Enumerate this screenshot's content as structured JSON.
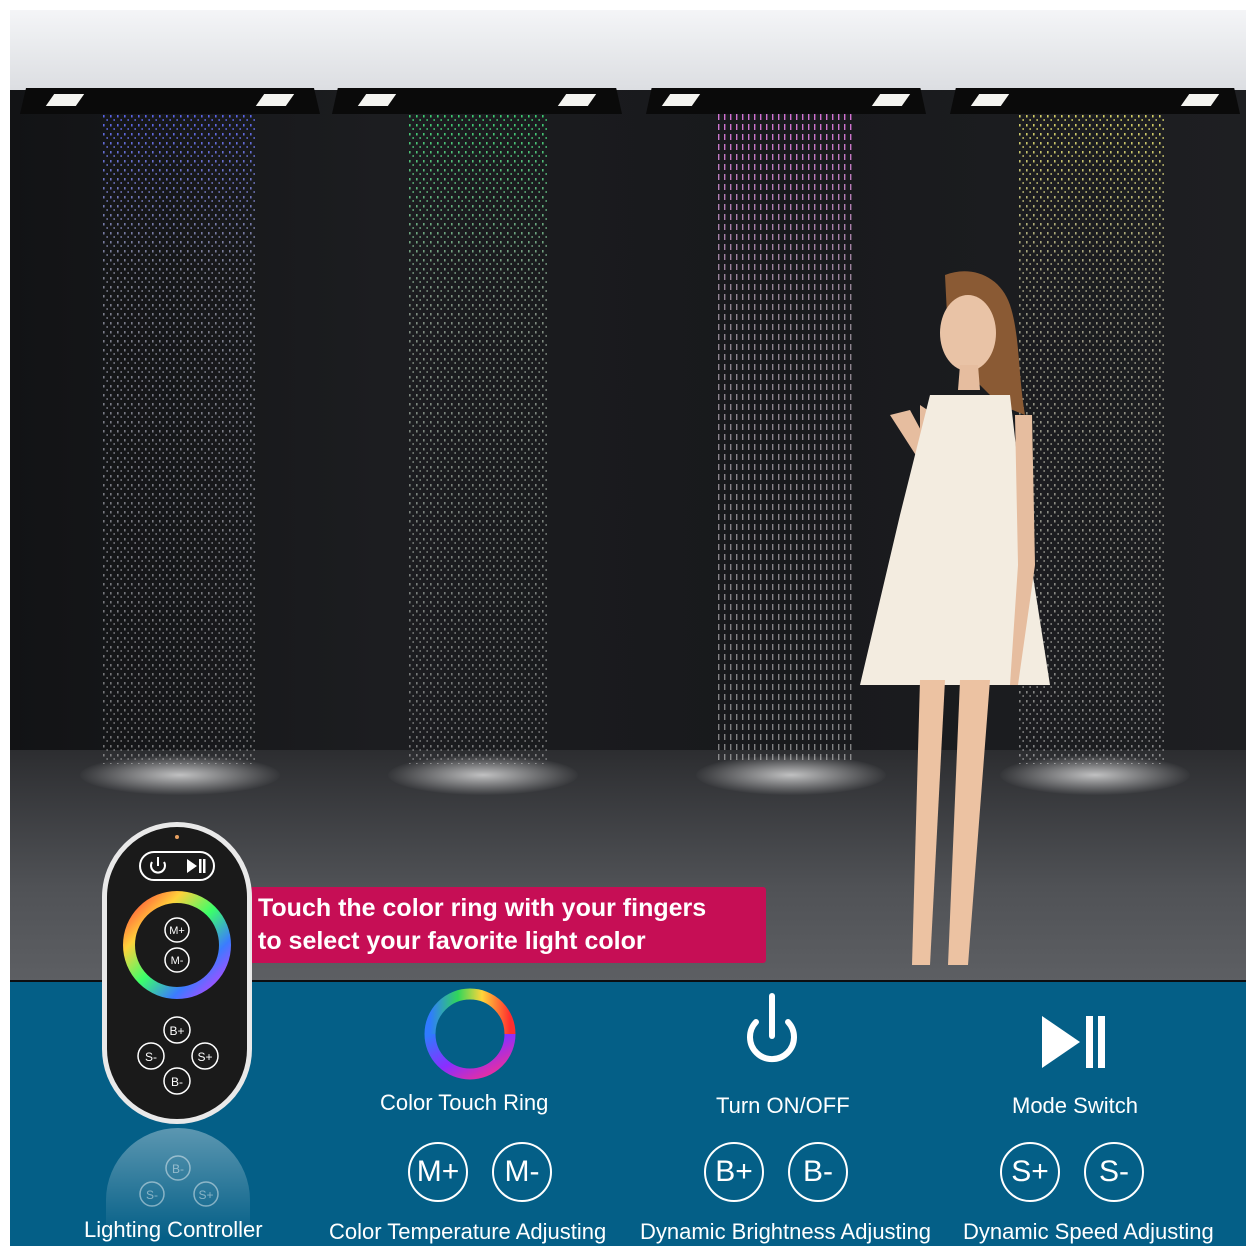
{
  "callout": {
    "line1": "Touch the color ring with your fingers",
    "line2": "to select your favorite light color"
  },
  "remote": {
    "ring_center_top": "M+",
    "ring_center_bottom": "M-",
    "b_plus": "B+",
    "s_minus": "S-",
    "s_plus": "S+",
    "b_minus": "B-",
    "reflect_b": "B-",
    "reflect_s_minus": "S-",
    "reflect_s_plus": "S+"
  },
  "features": {
    "lighting_controller": "Lighting Controller",
    "color_touch_ring": "Color Touch Ring",
    "turn_on_off": "Turn ON/OFF",
    "mode_switch": "Mode Switch",
    "color_temperature": "Color Temperature Adjusting",
    "brightness": "Dynamic Brightness Adjusting",
    "speed": "Dynamic Speed Adjusting"
  },
  "buttons": {
    "m_plus": "M+",
    "m_minus": "M-",
    "b_plus": "B+",
    "b_minus": "B-",
    "s_plus": "S+",
    "s_minus": "S-"
  },
  "icons": [
    "power-icon",
    "play-pause-icon",
    "color-ring-icon"
  ],
  "colors": {
    "band": "#045f87",
    "callout": "#c60e55"
  }
}
